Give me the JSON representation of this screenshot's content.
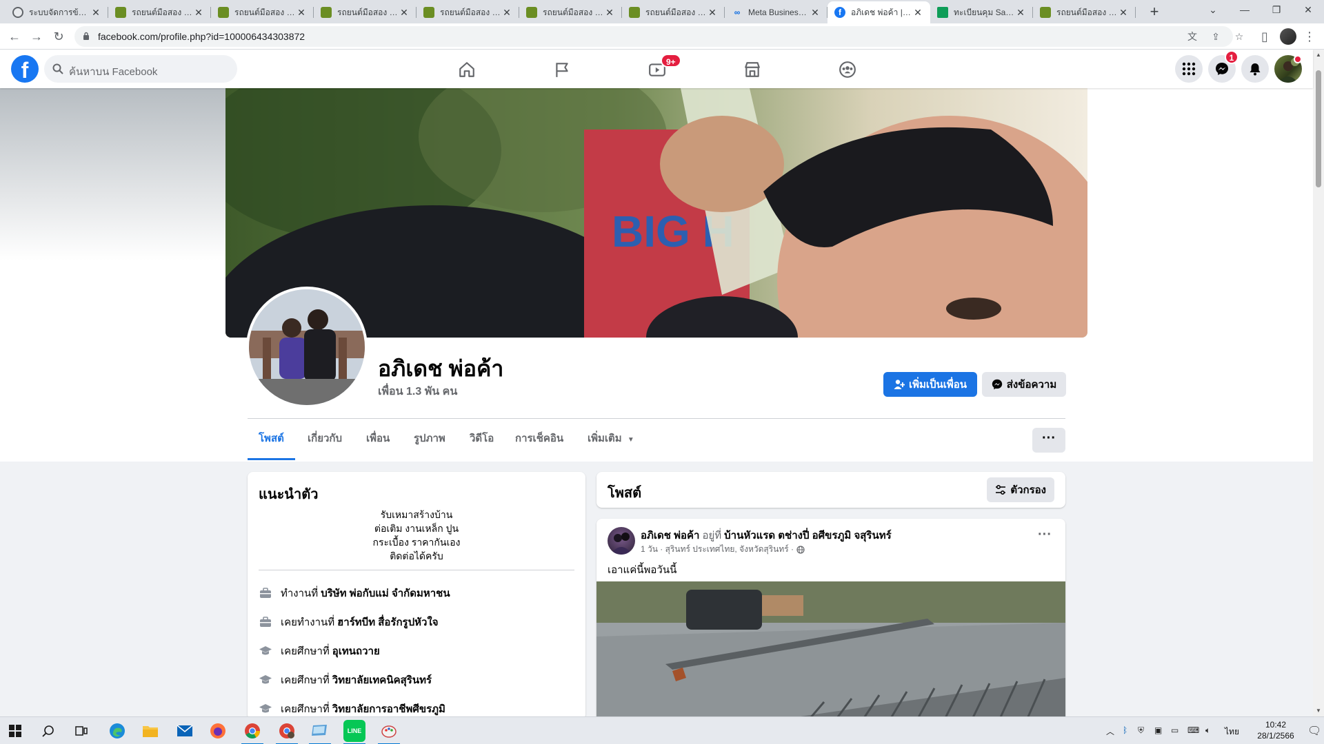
{
  "browser": {
    "tabs": [
      {
        "title": "ระบบจัดการข้อมูล",
        "favicon": "globe-icon"
      },
      {
        "title": "รถยนต์มือสอง โยธ",
        "favicon": "leaf-icon"
      },
      {
        "title": "รถยนต์มือสอง โยธ",
        "favicon": "leaf-icon"
      },
      {
        "title": "รถยนต์มือสอง โยธ",
        "favicon": "leaf-icon"
      },
      {
        "title": "รถยนต์มือสอง โยธ",
        "favicon": "leaf-icon"
      },
      {
        "title": "รถยนต์มือสอง โยธ",
        "favicon": "leaf-icon"
      },
      {
        "title": "รถยนต์มือสอง โยธ",
        "favicon": "leaf-icon"
      },
      {
        "title": "Meta Business S",
        "favicon": "meta-icon"
      },
      {
        "title": "อภิเดช พ่อค้า | Fa",
        "favicon": "facebook-icon",
        "active": true
      },
      {
        "title": "ทะเบียนคุม Sall ระ",
        "favicon": "sheets-icon"
      },
      {
        "title": "รถยนต์มือสอง โยธ",
        "favicon": "leaf-icon"
      }
    ],
    "new_tab": "+",
    "url": "facebook.com/profile.php?id=100006434303872"
  },
  "fb": {
    "search_placeholder": "ค้นหาบน Facebook",
    "video_badge": "9+",
    "messenger_badge": "1",
    "colors": {
      "brand": "#1877f2",
      "badge": "#e41e3f",
      "button": "#1b74e4"
    }
  },
  "profile": {
    "name": "อภิเดช พ่อค้า",
    "friends": "เพื่อน 1.3 พัน คน",
    "add_friend": "เพิ่มเป็นเพื่อน",
    "message": "ส่งข้อความ",
    "tabs": [
      "โพสต์",
      "เกี่ยวกับ",
      "เพื่อน",
      "รูปภาพ",
      "วิดีโอ",
      "การเช็คอิน",
      "เพิ่มเติม"
    ],
    "more_dots": "···"
  },
  "intro": {
    "title": "แนะนำตัว",
    "bio": [
      "รับเหมาสร้างบ้าน",
      "ต่อเติม งานเหล็ก ปูน",
      "กระเบื้อง ราคากันเอง",
      "ติดต่อได้ครับ"
    ],
    "items": [
      {
        "icon": "briefcase-icon",
        "prefix": "ทำงานที่",
        "value": "บริษัท พ่อกับแม่ จำกัดมหาชน"
      },
      {
        "icon": "briefcase-icon",
        "prefix": "เคยทำงานที่",
        "value": "ฮาร์ทบีท สื่อรักรูปหัวใจ"
      },
      {
        "icon": "graduation-cap-icon",
        "prefix": "เคยศึกษาที่",
        "value": "อุเทนถวาย"
      },
      {
        "icon": "graduation-cap-icon",
        "prefix": "เคยศึกษาที่",
        "value": "วิทยาลัยเทคนิคสุรินทร์"
      },
      {
        "icon": "graduation-cap-icon",
        "prefix": "เคยศึกษาที่",
        "value": "วิทยาลัยการอาชีพศีขรภูมิ"
      }
    ]
  },
  "posts": {
    "title": "โพสต์",
    "filter": "ตัวกรอง",
    "post": {
      "author": "อภิเดช พ่อค้า",
      "at": "อยู่ที่",
      "location": "บ้านหัวแรด ตช่างปี่ อศีขรภูมิ จสุรินทร์",
      "meta": "1 วัน · สุรินทร์ ประเทศไทย, จังหวัดสุรินทร์ ·",
      "text": "เอาแค่นี้พอวันนี้"
    }
  },
  "taskbar": {
    "lang": "ไทย",
    "time": "10:42",
    "date": "28/1/2566"
  }
}
